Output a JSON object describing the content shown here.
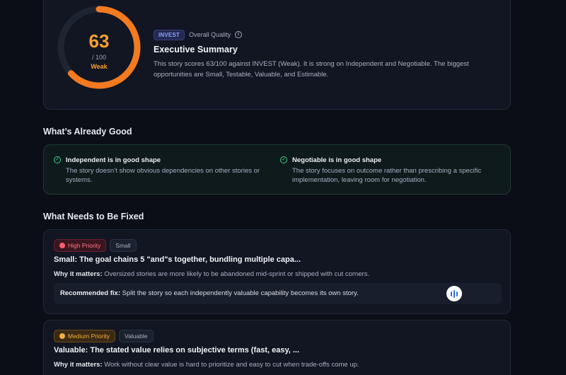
{
  "summary": {
    "score": "63",
    "max": "/ 100",
    "score_value": 63,
    "score_fraction": 0.63,
    "rating": "Weak",
    "badge": "INVEST",
    "quality_label": "Overall Quality",
    "title": "Executive Summary",
    "text": "This story scores 63/100 against INVEST (Weak). It is strong on Independent and Negotiable. The biggest opportunities are Small, Testable, Valuable, and Estimable."
  },
  "good": {
    "heading": "What’s Already Good",
    "items": [
      {
        "title": "Independent is in good shape",
        "text": "The story doesn’t show obvious dependencies on other stories or systems."
      },
      {
        "title": "Negotiable is in good shape",
        "text": "The story focuses on outcome rather than prescribing a specific implementation, leaving room for negotiation."
      }
    ]
  },
  "fixes": {
    "heading": "What Needs to Be Fixed",
    "items": [
      {
        "priority": "High Priority",
        "category": "Small",
        "title": "Small: The goal chains 5 \"and\"s together, bundling multiple capa...",
        "why_label": "Why it matters:",
        "why_text": " Oversized stories are more likely to be abandoned mid-sprint or shipped with cut corners.",
        "rec_label": "Recommended fix:",
        "rec_text": " Split the story so each independently valuable capability becomes its own story."
      },
      {
        "priority": "Medium Priority",
        "category": "Valuable",
        "title": "Valuable: The stated value relies on subjective terms (fast, easy, ...",
        "why_label": "Why it matters:",
        "why_text": " Work without clear value is hard to prioritize and easy to cut when trade-offs come up."
      }
    ]
  },
  "colors": {
    "score_accent": "#f59f2e",
    "gauge_arc": "#f47a1f",
    "good_accent": "#3ecf8e",
    "high_priority": "#ff5c6c",
    "medium_priority": "#f3b13a"
  },
  "icons": {
    "info": "info-icon",
    "check": "check-circle-icon",
    "voice": "voice-wave-icon"
  }
}
